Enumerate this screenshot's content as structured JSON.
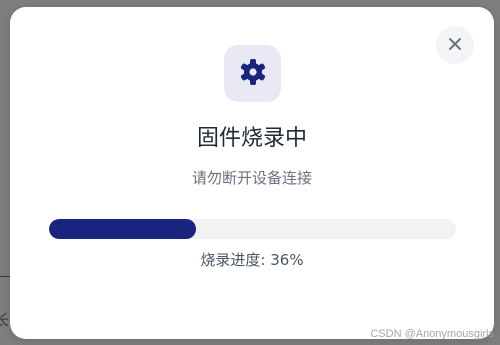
{
  "dialog": {
    "title": "固件烧录中",
    "subtitle": "请勿断开设备连接",
    "progress": {
      "label": "烧录进度",
      "separator": ": ",
      "percent": 36
    },
    "icons": {
      "main": "gear-icon",
      "close": "close-icon"
    }
  },
  "background": {
    "partial_text": "长"
  },
  "watermark": "CSDN @Anonymousgirls",
  "colors": {
    "accent": "#1a237e",
    "icon_tile": "#e8e9f5",
    "track": "#f1f2f4",
    "close_bg": "#f3f4f6",
    "title": "#1f2937",
    "subtitle": "#6b7280",
    "overlay": "#7e7e7e"
  }
}
